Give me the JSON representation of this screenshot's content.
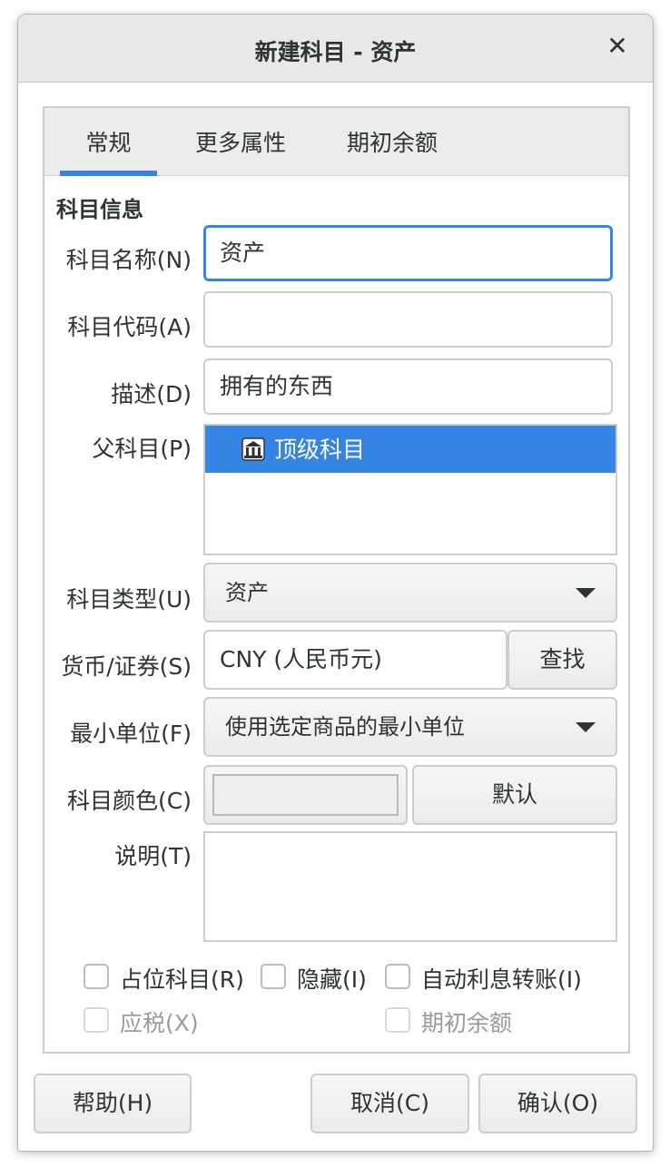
{
  "window": {
    "title": "新建科目 - 资产",
    "close_glyph": "✕"
  },
  "tabs": [
    {
      "label": "常规",
      "active": true
    },
    {
      "label": "更多属性",
      "active": false
    },
    {
      "label": "期初余额",
      "active": false
    }
  ],
  "section_title": "科目信息",
  "fields": {
    "name": {
      "label": "科目名称(N)",
      "value": "资产"
    },
    "code": {
      "label": "科目代码(A)",
      "value": ""
    },
    "description": {
      "label": "描述(D)",
      "value": "拥有的东西"
    },
    "parent": {
      "label": "父科目(P)",
      "selected": "顶级科目",
      "icon": "bank-icon"
    },
    "type": {
      "label": "科目类型(U)",
      "value": "资产"
    },
    "currency": {
      "label": "货币/证券(S)",
      "value": "CNY (人民币元)",
      "button": "查找"
    },
    "smallest_unit": {
      "label": "最小单位(F)",
      "value": "使用选定商品的最小单位"
    },
    "color": {
      "label": "科目颜色(C)",
      "button": "默认"
    },
    "notes": {
      "label": "说明(T)",
      "value": ""
    }
  },
  "checkboxes": [
    {
      "label": "占位科目(R)",
      "checked": false,
      "enabled": true
    },
    {
      "label": "隐藏(I)",
      "checked": false,
      "enabled": true
    },
    {
      "label": "自动利息转账(I)",
      "checked": false,
      "enabled": true
    },
    {
      "label": "应税(X)",
      "checked": false,
      "enabled": false
    },
    {
      "label": "期初余额",
      "checked": false,
      "enabled": false
    }
  ],
  "footer": {
    "help": "帮助(H)",
    "cancel": "取消(C)",
    "ok": "确认(O)"
  },
  "colors": {
    "accent": "#3584e4",
    "titlebar": "#e8e8e7",
    "tabbar": "#ececeb"
  }
}
